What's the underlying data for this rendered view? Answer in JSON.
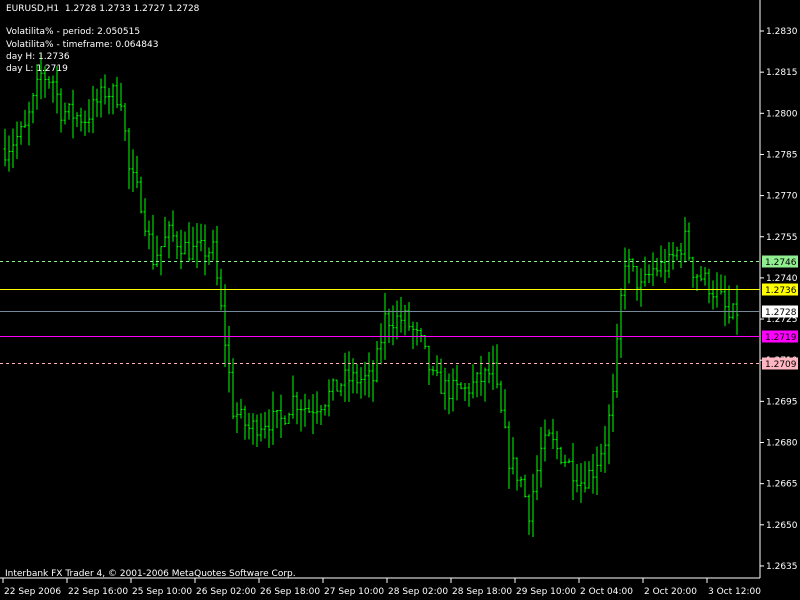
{
  "header": {
    "symbol": "EURUSD,H1",
    "ohlc": "1.2728 1.2733 1.2727 1.2728"
  },
  "indicator": {
    "lines": [
      "Volatilita% - period: 2.050515",
      "Volatilita% - timeframe: 0.064843",
      "day H: 1.2736",
      "day L: 1.2719"
    ]
  },
  "footer": {
    "copyright": "Interbank FX Trader 4, © 2001-2006 MetaQuotes Software Corp."
  },
  "colors": {
    "bar": "#00ff00",
    "background": "#000000",
    "axis": "#ffffff"
  },
  "chart_data": {
    "type": "ohlc",
    "title": "EURUSD,H1",
    "ylim": [
      1.2628,
      1.2842
    ],
    "price_ticks": [
      "1.2830",
      "1.2815",
      "1.2800",
      "1.2785",
      "1.2770",
      "1.2755",
      "1.2740",
      "1.2725",
      "1.2710",
      "1.2695",
      "1.2680",
      "1.2665",
      "1.2650",
      "1.2635"
    ],
    "time_ticks": [
      {
        "bar": 0,
        "label": "22 Sep 2006"
      },
      {
        "bar": 16,
        "label": "22 Sep 16:00"
      },
      {
        "bar": 32,
        "label": "25 Sep 10:00"
      },
      {
        "bar": 48,
        "label": "26 Sep 02:00"
      },
      {
        "bar": 64,
        "label": "26 Sep 18:00"
      },
      {
        "bar": 80,
        "label": "27 Sep 10:00"
      },
      {
        "bar": 96,
        "label": "28 Sep 02:00"
      },
      {
        "bar": 112,
        "label": "28 Sep 18:00"
      },
      {
        "bar": 128,
        "label": "29 Sep 10:00"
      },
      {
        "bar": 144,
        "label": "2 Oct 04:00"
      },
      {
        "bar": 160,
        "label": "2 Oct 20:00"
      },
      {
        "bar": 176,
        "label": "3 Oct 12:00"
      }
    ],
    "bar_count": 184,
    "close_path": [
      [
        0,
        1.2787
      ],
      [
        5,
        1.2794
      ],
      [
        9,
        1.2814
      ],
      [
        12,
        1.2812
      ],
      [
        14,
        1.2801
      ],
      [
        20,
        1.2798
      ],
      [
        25,
        1.2808
      ],
      [
        29,
        1.2806
      ],
      [
        31,
        1.2779
      ],
      [
        34,
        1.2768
      ],
      [
        37,
        1.2747
      ],
      [
        41,
        1.2756
      ],
      [
        46,
        1.275
      ],
      [
        52,
        1.275
      ],
      [
        55,
        1.2717
      ],
      [
        57,
        1.2692
      ],
      [
        61,
        1.2685
      ],
      [
        65,
        1.2688
      ],
      [
        69,
        1.2688
      ],
      [
        72,
        1.2696
      ],
      [
        76,
        1.2692
      ],
      [
        80,
        1.2696
      ],
      [
        85,
        1.2703
      ],
      [
        89,
        1.2703
      ],
      [
        92,
        1.2703
      ],
      [
        95,
        1.2725
      ],
      [
        100,
        1.2725
      ],
      [
        104,
        1.2716
      ],
      [
        107,
        1.2703
      ],
      [
        111,
        1.2699
      ],
      [
        115,
        1.2699
      ],
      [
        119,
        1.2703
      ],
      [
        122,
        1.2706
      ],
      [
        126,
        1.2674
      ],
      [
        129,
        1.2666
      ],
      [
        131,
        1.2655
      ],
      [
        134,
        1.2677
      ],
      [
        136,
        1.2681
      ],
      [
        140,
        1.2674
      ],
      [
        144,
        1.2666
      ],
      [
        147,
        1.267
      ],
      [
        150,
        1.2681
      ],
      [
        152,
        1.2696
      ],
      [
        154,
        1.2732
      ],
      [
        155,
        1.2747
      ],
      [
        159,
        1.2736
      ],
      [
        162,
        1.2743
      ],
      [
        166,
        1.2745
      ],
      [
        170,
        1.2754
      ],
      [
        172,
        1.2743
      ],
      [
        175,
        1.2739
      ],
      [
        179,
        1.2732
      ],
      [
        181,
        1.2725
      ],
      [
        183,
        1.2728
      ]
    ],
    "levels": [
      {
        "name": "level-high-dashed",
        "value": 1.2746,
        "label": "1.2746",
        "color": "#90ee90",
        "label_bg": "#90ee90",
        "dashed": true
      },
      {
        "name": "day-high",
        "value": 1.2736,
        "label": "1.2736",
        "color": "#ffff00",
        "label_bg": "#ffff00",
        "dashed": false
      },
      {
        "name": "bid",
        "value": 1.2728,
        "label": "1.2728",
        "color": "#778899",
        "label_bg": "#ffffff",
        "dashed": false
      },
      {
        "name": "day-low",
        "value": 1.2719,
        "label": "1.2719",
        "color": "#ff00ff",
        "label_bg": "#ff00ff",
        "dashed": false
      },
      {
        "name": "level-low-dashed",
        "value": 1.2709,
        "label": "1.2709",
        "color": "#ffb6c1",
        "label_bg": "#ffb6c1",
        "dashed": true
      }
    ]
  }
}
